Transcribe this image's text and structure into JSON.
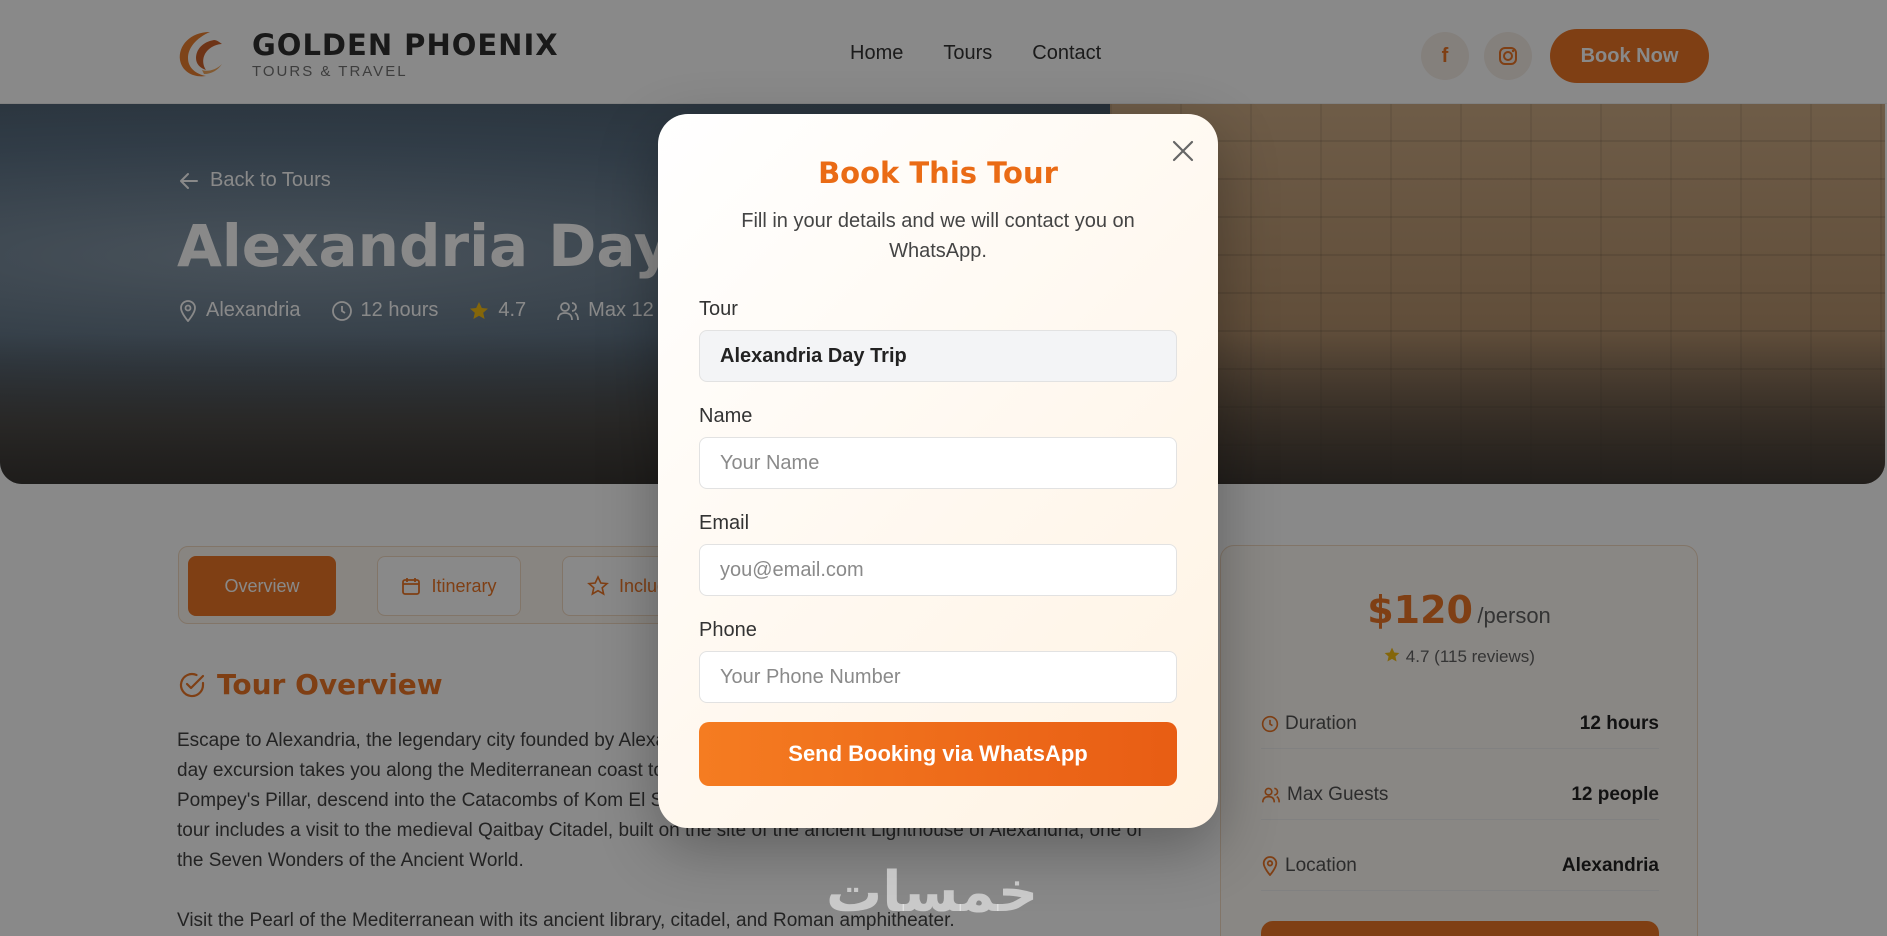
{
  "header": {
    "brand": "GOLDEN PHOENIX",
    "tagline": "TOURS & TRAVEL",
    "nav": [
      "Home",
      "Tours",
      "Contact"
    ],
    "book_now": "Book Now",
    "social_icons": [
      "facebook-icon",
      "instagram-icon"
    ]
  },
  "hero": {
    "back_link": "Back to Tours",
    "title": "Alexandria Day Trip",
    "location": "Alexandria",
    "duration": "12 hours",
    "rating": "4.7",
    "max_guests": "Max 12"
  },
  "tabs": [
    "Overview",
    "Itinerary",
    "Included"
  ],
  "overview": {
    "title": "Tour Overview",
    "paragraph1": "Escape to Alexandria, the legendary city founded by Alexander the Great and home to the ancient library. This full-day excursion takes you along the Mediterranean coast to discover Alexandria's rich heritage. Visit the impressive Pompey's Pillar, descend into the Catacombs of Kom El Shoqafa, and explore the modern Library of Alexandria. The tour includes a visit to the medieval Qaitbay Citadel, built on the site of the ancient Lighthouse of Alexandria, one of the Seven Wonders of the Ancient World.",
    "paragraph2": "Visit the Pearl of the Mediterranean with its ancient library, citadel, and Roman amphitheater."
  },
  "price_card": {
    "price": "$120",
    "unit": "/person",
    "rating": "4.7 (115 reviews)",
    "rows": [
      {
        "label": "Duration",
        "value": "12 hours"
      },
      {
        "label": "Max Guests",
        "value": "12 people"
      },
      {
        "label": "Location",
        "value": "Alexandria"
      }
    ]
  },
  "modal": {
    "title": "Book This Tour",
    "subtitle": "Fill in your details and we will contact you on WhatsApp.",
    "tour_label": "Tour",
    "tour_value": "Alexandria Day Trip",
    "name_label": "Name",
    "name_placeholder": "Your Name",
    "email_label": "Email",
    "email_placeholder": "you@email.com",
    "phone_label": "Phone",
    "phone_placeholder": "Your Phone Number",
    "submit": "Send Booking via WhatsApp"
  },
  "watermark": "خمسات",
  "colors": {
    "accent": "#ea6b15",
    "overlay": "rgba(20,20,20,0.50)"
  }
}
